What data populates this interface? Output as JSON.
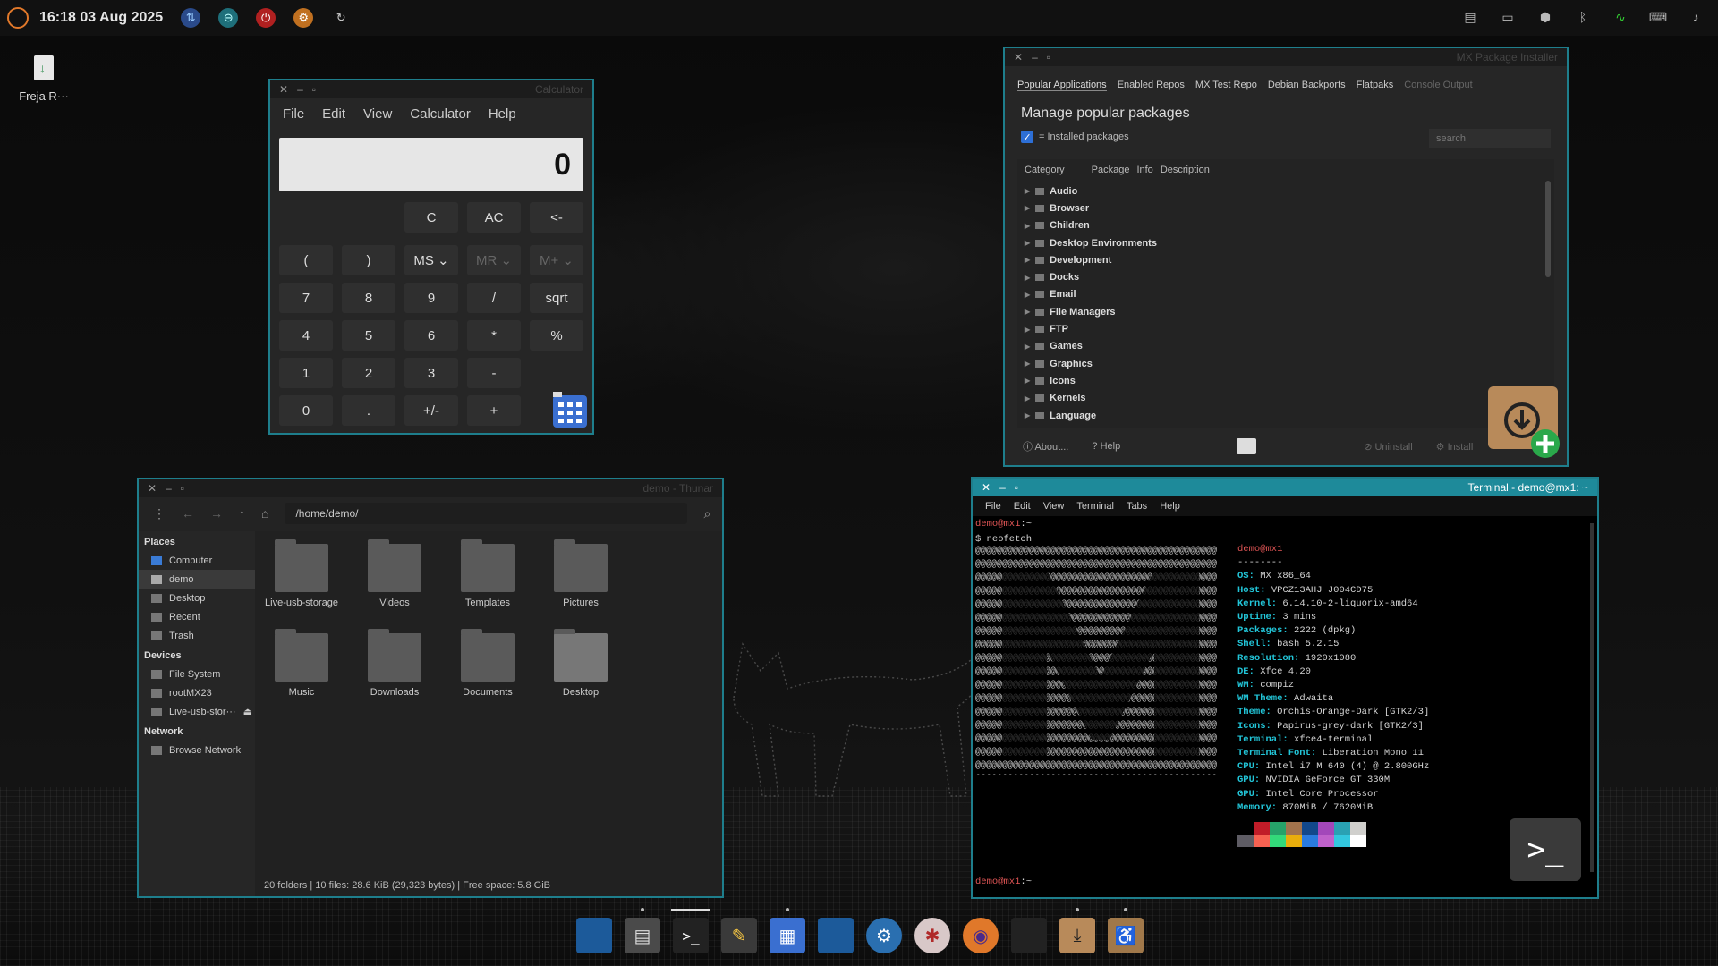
{
  "panel": {
    "clock": "16:18 03 Aug 2025"
  },
  "desktop": {
    "icon_label": "Freja R···"
  },
  "calculator": {
    "title": "Calculator",
    "menu": [
      "File",
      "Edit",
      "View",
      "Calculator",
      "Help"
    ],
    "display": "0",
    "keys": {
      "c": "C",
      "ac": "AC",
      "back": "<-",
      "lparen": "(",
      "rparen": ")",
      "ms": "MS ⌄",
      "mr": "MR ⌄",
      "mplus": "M+ ⌄",
      "k7": "7",
      "k8": "8",
      "k9": "9",
      "div": "/",
      "sqrt": "sqrt",
      "k4": "4",
      "k5": "5",
      "k6": "6",
      "mul": "*",
      "pct": "%",
      "k1": "1",
      "k2": "2",
      "k3": "3",
      "sub": "-",
      "k0": "0",
      "dot": ".",
      "neg": "+/-",
      "add": "+"
    }
  },
  "packages": {
    "title": "MX Package Installer",
    "tabs": [
      "Popular Applications",
      "Enabled Repos",
      "MX Test Repo",
      "Debian Backports",
      "Flatpaks",
      "Console Output"
    ],
    "heading": "Manage popular packages",
    "installed_label": "= Installed packages",
    "search_placeholder": "search",
    "columns": [
      "Category",
      "Package",
      "Info",
      "Description"
    ],
    "categories": [
      "Audio",
      "Browser",
      "Children",
      "Desktop Environments",
      "Development",
      "Docks",
      "Email",
      "File Managers",
      "FTP",
      "Games",
      "Graphics",
      "Icons",
      "Kernels",
      "Language"
    ],
    "buttons": {
      "about": "About...",
      "help": "Help",
      "uninstall": "Uninstall",
      "install": "Install"
    }
  },
  "filemanager": {
    "title": "demo - Thunar",
    "path": "/home/demo/",
    "places_header": "Places",
    "places": [
      "Computer",
      "demo",
      "Desktop",
      "Recent",
      "Trash"
    ],
    "devices_header": "Devices",
    "devices": [
      "File System",
      "rootMX23",
      "Live-usb-stor···"
    ],
    "network_header": "Network",
    "network": [
      "Browse Network"
    ],
    "items": [
      "Live-usb-storage",
      "Videos",
      "Templates",
      "Pictures",
      "Music",
      "Downloads",
      "Documents",
      "Desktop"
    ],
    "status": "20 folders  |  10 files: 28.6 KiB (29,323 bytes)  |  Free space: 5.8 GiB"
  },
  "terminal": {
    "title": "Terminal - demo@mx1: ~",
    "menu": [
      "File",
      "Edit",
      "View",
      "Terminal",
      "Tabs",
      "Help"
    ],
    "prompt1_user": "demo@mx1",
    "prompt1_path": ":~",
    "command": "$ neofetch",
    "header_user": "demo@mx1",
    "header_sep": "--------",
    "info": [
      {
        "k": "OS:",
        "v": "MX x86_64"
      },
      {
        "k": "Host:",
        "v": "VPCZ13AHJ J004CD75"
      },
      {
        "k": "Kernel:",
        "v": "6.14.10-2-liquorix-amd64"
      },
      {
        "k": "Uptime:",
        "v": "3 mins"
      },
      {
        "k": "Packages:",
        "v": "2222 (dpkg)"
      },
      {
        "k": "Shell:",
        "v": "bash 5.2.15"
      },
      {
        "k": "Resolution:",
        "v": "1920x1080"
      },
      {
        "k": "DE:",
        "v": "Xfce 4.20"
      },
      {
        "k": "WM:",
        "v": "compiz"
      },
      {
        "k": "WM Theme:",
        "v": "Adwaita"
      },
      {
        "k": "Theme:",
        "v": "Orchis-Orange-Dark [GTK2/3]"
      },
      {
        "k": "Icons:",
        "v": "Papirus-grey-dark [GTK2/3]"
      },
      {
        "k": "Terminal:",
        "v": "xfce4-terminal"
      },
      {
        "k": "Terminal Font:",
        "v": "Liberation Mono 11"
      },
      {
        "k": "CPU:",
        "v": "Intel i7 M 640 (4) @ 2.800GHz"
      },
      {
        "k": "GPU:",
        "v": "NVIDIA GeForce GT 330M"
      },
      {
        "k": "GPU:",
        "v": "Intel Core Processor"
      },
      {
        "k": "Memory:",
        "v": "870MiB / 7620MiB"
      }
    ],
    "prompt2_user": "demo@mx1",
    "prompt2_path": ":~"
  },
  "colors": {
    "accent": "#1e7e8c",
    "terminal_title": "#1e8a9a",
    "prompt": "#e05555",
    "neofetch_key": "#22c5d8"
  }
}
